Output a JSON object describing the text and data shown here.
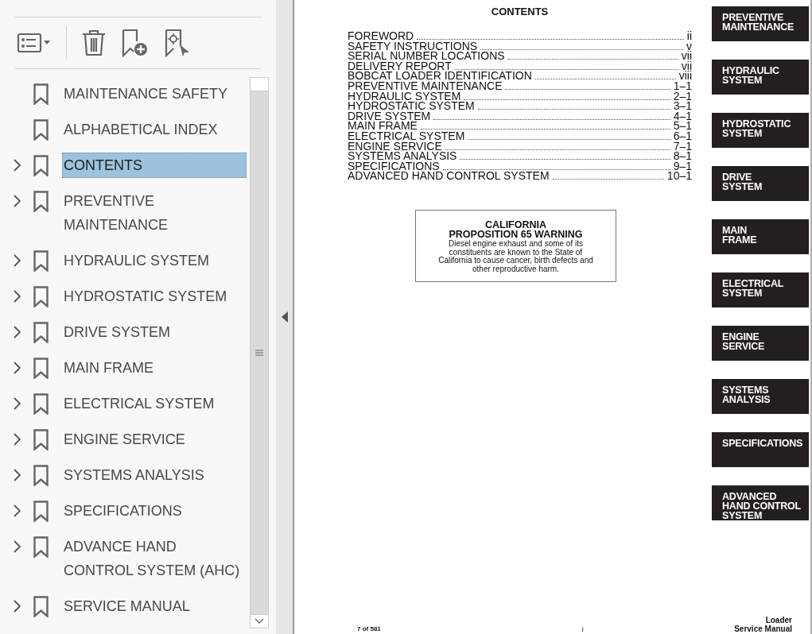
{
  "sidebar": {
    "bookmarks": [
      {
        "label": "MAINTENANCE SAFETY",
        "expandable": false,
        "selected": false
      },
      {
        "label": "ALPHABETICAL INDEX",
        "expandable": false,
        "selected": false
      },
      {
        "label": "CONTENTS",
        "expandable": true,
        "selected": true
      },
      {
        "label": "PREVENTIVE MAINTENANCE",
        "expandable": true,
        "selected": false
      },
      {
        "label": "HYDRAULIC SYSTEM",
        "expandable": true,
        "selected": false
      },
      {
        "label": "HYDROSTATIC SYSTEM",
        "expandable": true,
        "selected": false
      },
      {
        "label": "DRIVE SYSTEM",
        "expandable": true,
        "selected": false
      },
      {
        "label": "MAIN FRAME",
        "expandable": true,
        "selected": false
      },
      {
        "label": "ELECTRICAL SYSTEM",
        "expandable": true,
        "selected": false
      },
      {
        "label": "ENGINE SERVICE",
        "expandable": true,
        "selected": false
      },
      {
        "label": "SYSTEMS ANALYSIS",
        "expandable": true,
        "selected": false
      },
      {
        "label": "SPECIFICATIONS",
        "expandable": true,
        "selected": false
      },
      {
        "label": "ADVANCE HAND CONTROL SYSTEM (AHC)",
        "expandable": true,
        "selected": false
      },
      {
        "label": "SERVICE MANUAL",
        "expandable": true,
        "selected": false
      }
    ]
  },
  "document": {
    "title": "CONTENTS",
    "toc": [
      {
        "title": "FOREWORD",
        "page": "ii"
      },
      {
        "title": "SAFETY INSTRUCTIONS",
        "page": "v"
      },
      {
        "title": "SERIAL NUMBER LOCATIONS",
        "page": "vii"
      },
      {
        "title": "DELIVERY REPORT",
        "page": "vii"
      },
      {
        "title": "BOBCAT LOADER IDENTIFICATION",
        "page": "viii"
      },
      {
        "title": "PREVENTIVE MAINTENANCE",
        "page": "1–1"
      },
      {
        "title": "HYDRAULIC SYSTEM",
        "page": "2–1"
      },
      {
        "title": "HYDROSTATIC SYSTEM",
        "page": "3–1"
      },
      {
        "title": "DRIVE SYSTEM",
        "page": "4–1"
      },
      {
        "title": "MAIN FRAME",
        "page": "5–1"
      },
      {
        "title": "ELECTRICAL SYSTEM",
        "page": "6–1"
      },
      {
        "title": "ENGINE SERVICE",
        "page": "7–1"
      },
      {
        "title": "SYSTEMS ANALYSIS",
        "page": "8–1"
      },
      {
        "title": "SPECIFICATIONS",
        "page": "9–1"
      },
      {
        "title": "ADVANCED HAND CONTROL SYSTEM",
        "page": "10–1"
      }
    ],
    "warning": {
      "heading": [
        "CALIFORNIA",
        "PROPOSITION 65 WARNING"
      ],
      "text": "Diesel engine exhaust and some of its constituents are known to the State of California to cause cancer, birth defects and other reproductive harm."
    },
    "tabs": [
      {
        "lines": [
          "PREVENTIVE",
          "MAINTENANCE"
        ]
      },
      {
        "lines": [
          "HYDRAULIC",
          "SYSTEM"
        ]
      },
      {
        "lines": [
          "HYDROSTATIC",
          "SYSTEM"
        ]
      },
      {
        "lines": [
          "DRIVE",
          "SYSTEM"
        ]
      },
      {
        "lines": [
          "MAIN",
          "FRAME"
        ]
      },
      {
        "lines": [
          "ELECTRICAL",
          "SYSTEM"
        ]
      },
      {
        "lines": [
          "ENGINE",
          "SERVICE"
        ]
      },
      {
        "lines": [
          "SYSTEMS",
          "ANALYSIS"
        ]
      },
      {
        "lines": [
          "SPECIFICATIONS"
        ]
      },
      {
        "lines": [
          "ADVANCED",
          "HAND CONTROL",
          "SYSTEM"
        ]
      }
    ],
    "footer": {
      "page_count": "7 of 581",
      "folio": "i",
      "manual": [
        "Loader",
        "Service Manual"
      ]
    }
  }
}
